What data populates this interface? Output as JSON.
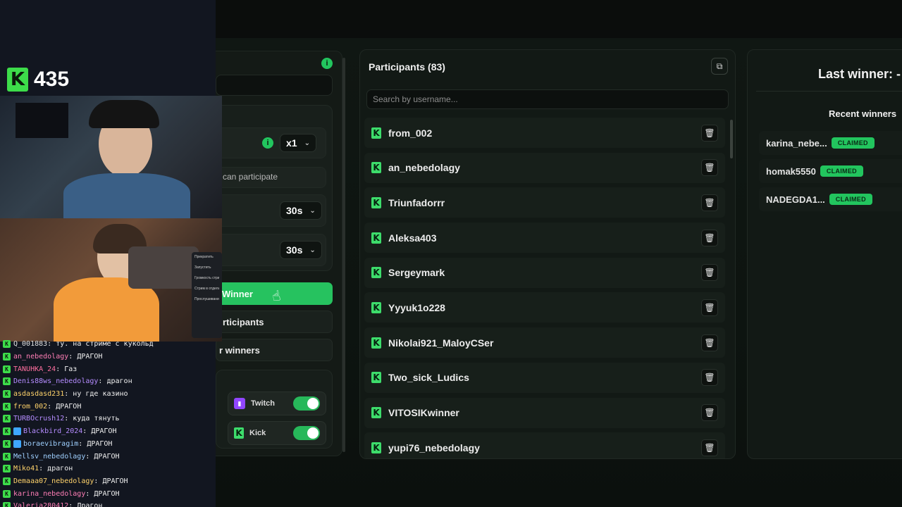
{
  "streamer_overlay": {
    "viewer_count": "435",
    "chat": [
      {
        "user": "Q_001883",
        "message": "ту. на стриме с кукольд",
        "color": "#e0e0e0",
        "extra_badge": false
      },
      {
        "user": "an_nebedolagy",
        "message": "ДРАГОН",
        "color": "#ff7eb6",
        "extra_badge": false
      },
      {
        "user": "TANUHKA_24",
        "message": "Газ",
        "color": "#ff6f9f",
        "extra_badge": false
      },
      {
        "user": "Denis88ws_nebedolagy",
        "message": "драгон",
        "color": "#b58cff",
        "extra_badge": false
      },
      {
        "user": "asdasdasd231",
        "message": "ну где казино",
        "color": "#ffd36b",
        "extra_badge": false
      },
      {
        "user": "from_002",
        "message": "ДРАГОН",
        "color": "#ffd36b",
        "extra_badge": false
      },
      {
        "user": "TURBOcrush12",
        "message": "куда тянуть",
        "color": "#b58cff",
        "extra_badge": false
      },
      {
        "user": "Blackbird_2024",
        "message": "ДРАГОН",
        "color": "#b58cff",
        "extra_badge": true
      },
      {
        "user": "boraevibragim",
        "message": "ДРАГОН",
        "color": "#9fd0ff",
        "extra_badge": true
      },
      {
        "user": "Mellsv_nebedolagy",
        "message": "ДРАГОН",
        "color": "#9fd0ff",
        "extra_badge": false
      },
      {
        "user": "Miko41",
        "message": "драгон",
        "color": "#ffd36b",
        "extra_badge": false
      },
      {
        "user": "Demaaa07_nebedolagy",
        "message": "ДРАГОН",
        "color": "#ffd36b",
        "extra_badge": false
      },
      {
        "user": "karina_nebedolagy",
        "message": "ДРАГОН",
        "color": "#ff7eb6",
        "extra_badge": false
      },
      {
        "user": "Valeria280412",
        "message": "Драгон",
        "color": "#ff7eb6",
        "extra_badge": false
      }
    ],
    "mini_menu": [
      "Прекратить",
      "Запустить",
      "Громкость стрима",
      "Стрим в отдельном",
      "Прослушивание"
    ]
  },
  "settings_panel": {
    "multiplier": "x1",
    "participation_hint": "can participate",
    "timer_1": "30s",
    "timer_2": "30s",
    "select_winner_label": "Winner",
    "participants_button_label": "rticipants",
    "winners_button_label": "r winners",
    "platforms": [
      {
        "name": "Twitch",
        "enabled": true
      },
      {
        "name": "Kick",
        "enabled": true
      }
    ]
  },
  "participants": {
    "title": "Participants (83)",
    "search_placeholder": "Search by username...",
    "list": [
      "from_002",
      "an_nebedolagy",
      "Triunfadorrr",
      "Aleksa403",
      "Sergeymark",
      "Yyyuk1o228",
      "Nikolai921_MaloyCSer",
      "Two_sick_Ludics",
      "VITOSIKwinner",
      "yupi76_nebedolagy"
    ]
  },
  "winners": {
    "last_winner_title": "Last winner: -",
    "recent_title": "Recent winners",
    "recent": [
      {
        "name": "karina_nebe...",
        "status": "CLAIMED"
      },
      {
        "name": "homak5550",
        "status": "CLAIMED"
      },
      {
        "name": "NADEGDA1...",
        "status": "CLAIMED"
      }
    ]
  },
  "colors": {
    "accent": "#22c55e",
    "kick_green": "#3ddc6b",
    "twitch_purple": "#9146ff",
    "panel_bg": "#121915"
  }
}
